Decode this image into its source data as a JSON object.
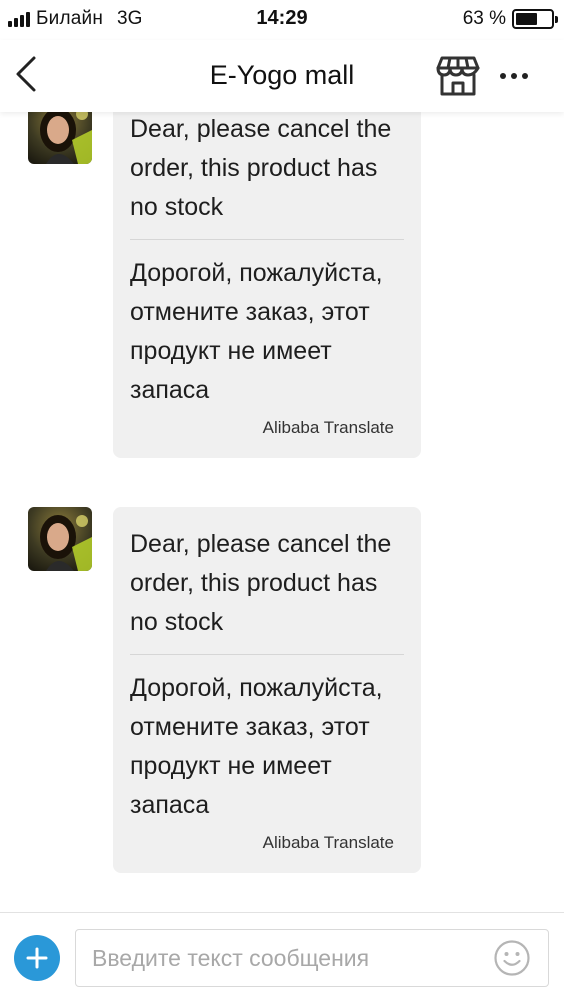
{
  "status_bar": {
    "carrier": "Билайн",
    "network": "3G",
    "time": "14:29",
    "battery_percent": "63 %",
    "battery_level": 0.63
  },
  "nav": {
    "title": "E-Yogo mall",
    "back_icon": "chevron-left-icon",
    "store_icon": "store-icon",
    "more_icon": "more-horizontal-icon"
  },
  "messages": [
    {
      "avatar_icon": "avatar-photo",
      "original": "Dear, please cancel the order, this product has no stock",
      "translation": "Дорогой, пожалуйста, отмените заказ, этот продукт не имеет запаса",
      "translation_source": "Alibaba Translate"
    },
    {
      "avatar_icon": "avatar-photo",
      "original": "Dear, please cancel the order, this product has no stock",
      "translation": "Дорогой, пожалуйста, отмените заказ, этот продукт не имеет запаса",
      "translation_source": "Alibaba Translate"
    }
  ],
  "input_bar": {
    "add_icon": "plus-icon",
    "placeholder": "Введите текст сообщения",
    "value": "",
    "emoji_icon": "smiley-icon"
  },
  "colors": {
    "accent": "#2a98d8",
    "bubble": "#f0f0f0",
    "divider": "#d6d6d6"
  }
}
